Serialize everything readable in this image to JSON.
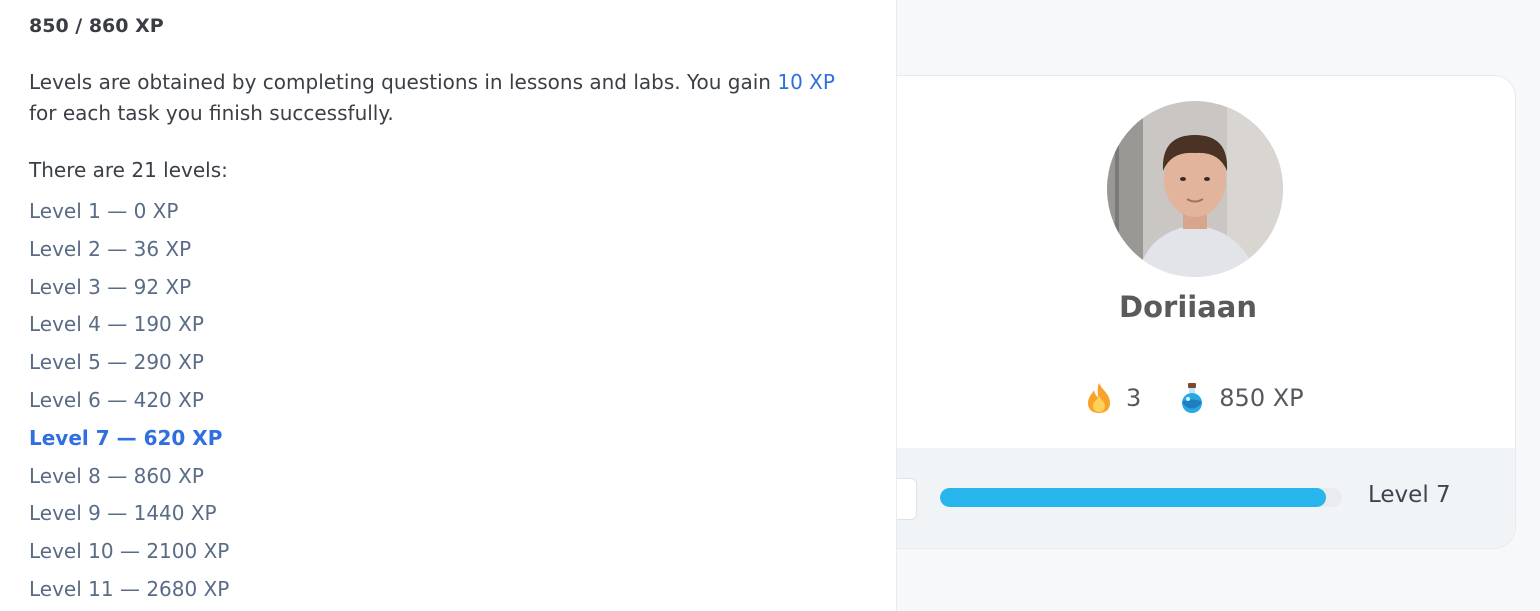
{
  "info": {
    "xp_total": "850 / 860 XP",
    "description_before": "Levels are obtained by completing questions in lessons and labs. You gain ",
    "description_accent": "10 XP",
    "description_after": " for each task you finish successfully.",
    "levels_count_text": "There are 21 levels:",
    "levels": [
      "Level 1 — 0 XP",
      "Level 2 — 36 XP",
      "Level 3 — 92 XP",
      "Level 4 — 190 XP",
      "Level 5 — 290 XP",
      "Level 6 — 420 XP",
      "Level 7 — 620 XP",
      "Level 8 — 860 XP",
      "Level 9 — 1440 XP",
      "Level 10 — 2100 XP",
      "Level 11 — 2680 XP"
    ],
    "current_level_index": 6
  },
  "profile": {
    "username": "Doriiaan",
    "streak_icon": "flame-icon",
    "streak_count": "3",
    "xp_icon": "potion-icon",
    "xp_value": "850 XP",
    "level_label": "Level 7",
    "progress_fraction": 0.96,
    "progress_color": "#27b5ec",
    "accent_color": "#2f6fdf"
  }
}
